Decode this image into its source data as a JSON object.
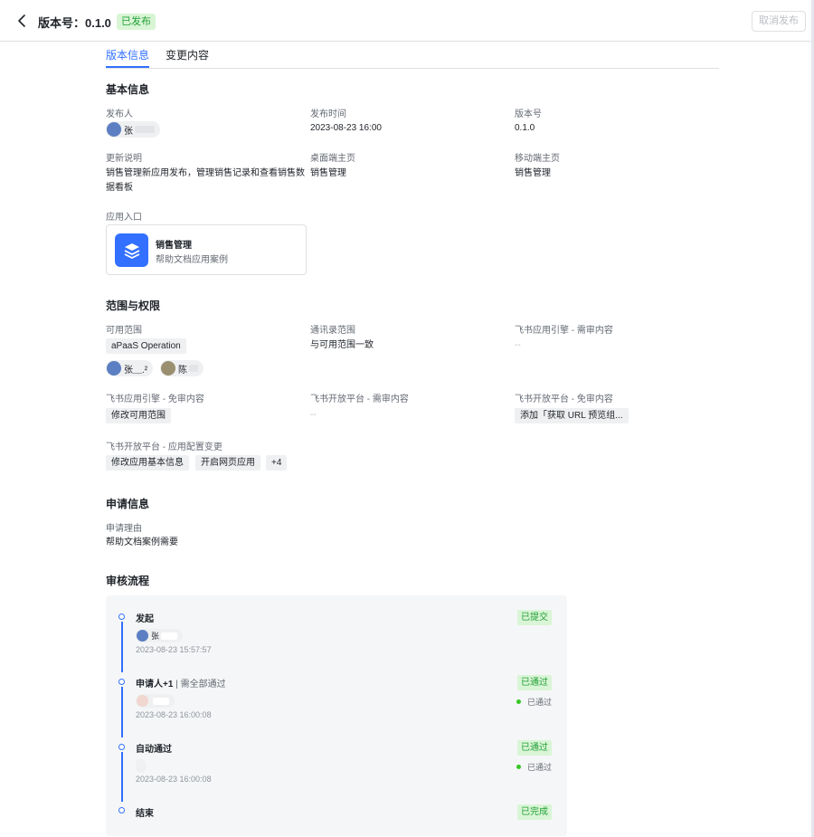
{
  "header": {
    "title": "版本号：0.1.0",
    "status": "已发布",
    "cancel_label": "取消发布"
  },
  "tabs": [
    {
      "label": "版本信息",
      "active": true
    },
    {
      "label": "变更内容",
      "active": false
    }
  ],
  "basic": {
    "title": "基本信息",
    "publisher_label": "发布人",
    "publisher_name": "张",
    "publish_time_label": "发布时间",
    "publish_time": "2023-08-23 16:00",
    "version_label": "版本号",
    "version": "0.1.0",
    "notes_label": "更新说明",
    "notes": "销售管理新应用发布，管理销售记录和查看销售数据看板",
    "desktop_label": "桌面端主页",
    "desktop": "销售管理",
    "mobile_label": "移动端主页",
    "mobile": "销售管理",
    "entry_label": "应用入口",
    "entry_name": "销售管理",
    "entry_desc": "帮助文档应用案例"
  },
  "scope": {
    "title": "范围与权限",
    "available_label": "可用范围",
    "available_dept": "aPaaS Operation",
    "available_users": [
      "张＿.²",
      "陈"
    ],
    "contacts_label": "通讯录范围",
    "contacts": "与可用范围一致",
    "engine_review_label": "飞书应用引擎 - 需审内容",
    "engine_review": "--",
    "engine_free_label": "飞书应用引擎 - 免审内容",
    "engine_free_tags": [
      "修改可用范围"
    ],
    "open_review_label": "飞书开放平台 - 需审内容",
    "open_review": "--",
    "open_free_label": "飞书开放平台 - 免审内容",
    "open_free_tags": [
      "添加「获取 URL 预览组..."
    ],
    "config_label": "飞书开放平台 - 应用配置变更",
    "config_tags": [
      "修改应用基本信息",
      "开启网页应用",
      "+4"
    ]
  },
  "apply": {
    "title": "申请信息",
    "reason_label": "申请理由",
    "reason": "帮助文档案例需要"
  },
  "flow": {
    "title": "审核流程",
    "nodes": [
      {
        "title": "发起",
        "sub": "",
        "user": "张",
        "time": "2023-08-23 15:57:57",
        "state": "已提交",
        "note": ""
      },
      {
        "title": "申请人+1",
        "sub": "| 需全部通过",
        "user": "",
        "time": "2023-08-23 16:00:08",
        "state": "已通过",
        "note": "已通过"
      },
      {
        "title": "自动通过",
        "sub": "",
        "user": "",
        "time": "2023-08-23 16:00:08",
        "state": "已通过",
        "note": "已通过"
      },
      {
        "title": "结束",
        "sub": "",
        "user": "",
        "time": "",
        "state": "已完成",
        "note": ""
      }
    ]
  },
  "icons": {
    "back": "chevron-left-icon",
    "entry": "stack-layers-icon"
  },
  "colors": {
    "accent": "#3370ff",
    "success": "#24a036",
    "success_bg": "#d9f5d6"
  }
}
